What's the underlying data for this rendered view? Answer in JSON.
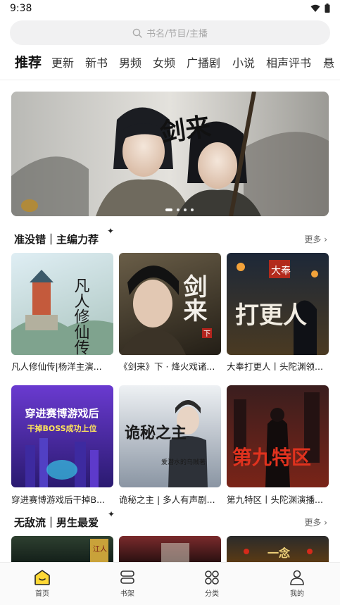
{
  "status_bar": {
    "time": "9:38"
  },
  "search": {
    "placeholder": "书名/节目/主播"
  },
  "tabs": [
    {
      "label": "推荐",
      "active": true
    },
    {
      "label": "更新"
    },
    {
      "label": "新书"
    },
    {
      "label": "男频"
    },
    {
      "label": "女频"
    },
    {
      "label": "广播剧"
    },
    {
      "label": "小说"
    },
    {
      "label": "相声评书"
    },
    {
      "label": "悬"
    }
  ],
  "banner": {
    "image": "wuxia-two-swordsmen-artwork",
    "cover_text": "剑来",
    "slides": 4,
    "active_slide": 1
  },
  "sections": [
    {
      "title": "准没错｜主编力荐",
      "more": "更多",
      "items": [
        {
          "title": "凡人修仙传|杨洋主演...",
          "cover_text": "凡人修仙传",
          "cover_badge": "",
          "colors": [
            "#cfe3ee",
            "#b9c8c2"
          ]
        },
        {
          "title": "《剑来》下 · 烽火戏诸...",
          "cover_text": "剑来",
          "cover_badge": "下",
          "colors": [
            "#5e5340",
            "#2a241b"
          ]
        },
        {
          "title": "大奉打更人丨头陀渊领...",
          "cover_text": "打更人",
          "cover_badge": "大奉",
          "colors": [
            "#1f2a3a",
            "#58401e"
          ]
        },
        {
          "title": "穿进赛博游戏后干掉B...",
          "cover_text": "穿进赛博游戏后",
          "cover_sub": "干掉BOSS成功上位",
          "cover_badge": "",
          "colors": [
            "#5b2bb8",
            "#2a1a6e"
          ]
        },
        {
          "title": "诡秘之主 | 多人有声剧...",
          "cover_text": "诡秘之主",
          "cover_sub": "爱潜水的乌贼著",
          "cover_badge": "",
          "colors": [
            "#d7dde4",
            "#7f8a98"
          ]
        },
        {
          "title": "第九特区丨头陀渊演播...",
          "cover_text": "第九特区",
          "cover_badge": "",
          "colors": [
            "#2d1a1a",
            "#8a2a1e"
          ]
        }
      ]
    },
    {
      "title": "无敌流｜男生最爱",
      "more": "更多",
      "items": [
        {
          "cover_text": "江人",
          "colors": [
            "#2b3b2c",
            "#13201a"
          ]
        },
        {
          "cover_text": "",
          "colors": [
            "#6a2628",
            "#2b1111"
          ]
        },
        {
          "cover_text": "一念",
          "colors": [
            "#2b2b2b",
            "#5a3a14"
          ]
        }
      ]
    }
  ],
  "bottom_nav": [
    {
      "label": "首页",
      "icon": "home-icon",
      "active": true
    },
    {
      "label": "书架",
      "icon": "bookshelf-icon"
    },
    {
      "label": "分类",
      "icon": "category-icon"
    },
    {
      "label": "我的",
      "icon": "profile-icon"
    }
  ],
  "colors": {
    "accent": "#fdd835",
    "highlight": "#fde68a",
    "text": "#222222"
  }
}
